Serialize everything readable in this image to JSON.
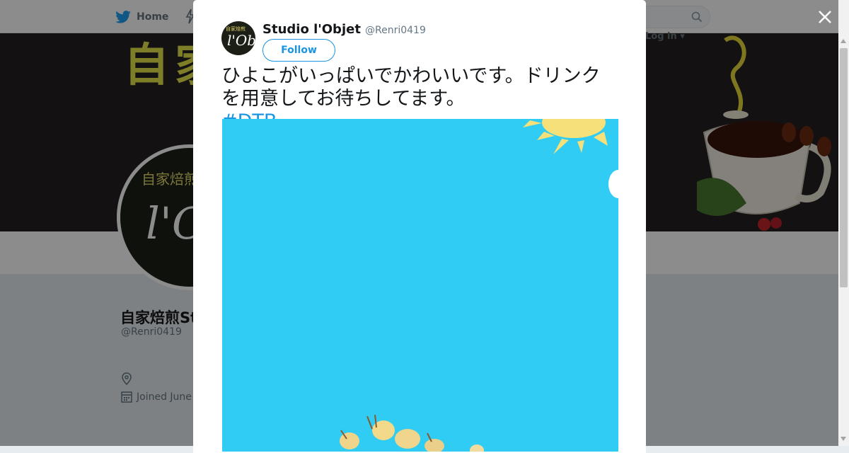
{
  "topbar": {
    "home_label": "Home",
    "login_label": "Log in"
  },
  "banner": {
    "kanji": "自家"
  },
  "avatar": {
    "cafe_text": "自家焙煎Cafe",
    "logo_text": "l'Obj"
  },
  "profile": {
    "name": "自家焙煎Stud",
    "handle": "@Renri0419",
    "joined": "Joined June"
  },
  "tweet": {
    "author_name": "Studio l'Objet",
    "author_handle": "@Renri0419",
    "follow_label": "Follow",
    "text": "ひよこがいっぱいでかわいいです。ドリンクを用意してお待ちしてます。",
    "hashtag": "#DTB"
  },
  "colors": {
    "accent": "#1b95e0",
    "media_sky": "#30ccf4",
    "banner_bg": "#231f20"
  },
  "icons": [
    "twitter-bird-icon",
    "lightning-icon",
    "search-icon",
    "close-icon",
    "location-icon",
    "calendar-icon",
    "sun-icon"
  ]
}
